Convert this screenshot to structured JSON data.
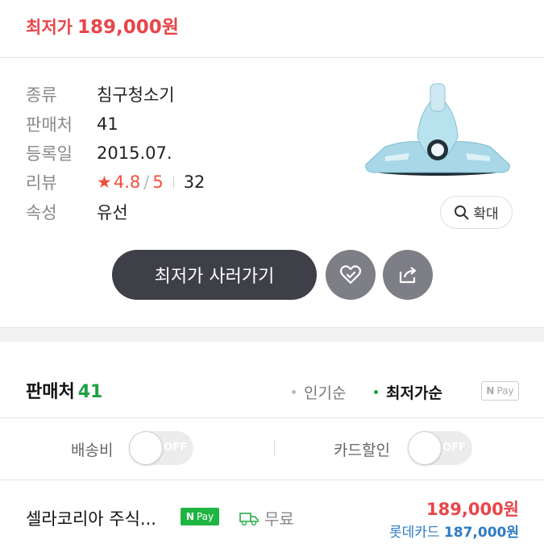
{
  "top": {
    "price_label": "최저가",
    "price": "189,000원"
  },
  "specs": [
    {
      "key": "종류",
      "value": "침구청소기"
    },
    {
      "key": "판매처",
      "value": "41"
    },
    {
      "key": "등록일",
      "value": "2015.07."
    },
    {
      "key": "리뷰",
      "rating": "4.8",
      "rating_max": "5",
      "count": "32"
    },
    {
      "key": "속성",
      "value": "유선"
    }
  ],
  "zoom_label": "확대",
  "buy_label": "최저가 사러가기",
  "sellers": {
    "title": "판매처",
    "count": "41",
    "sort_popular": "인기순",
    "sort_lowest": "최저가순",
    "npay_n": "N",
    "npay_label": "Pay"
  },
  "filters": {
    "shipping_label": "배송비",
    "card_label": "카드할인",
    "toggle_state": "OFF"
  },
  "rows": [
    {
      "name": "셀라코리아 주식...",
      "npay_n": "N",
      "npay_label": "Pay",
      "shipping": "무료",
      "price": "189,000원",
      "card_name": "롯데카드",
      "card_price": "187,000원"
    }
  ],
  "colors": {
    "accent": "#e8464a",
    "green": "#1fa045",
    "card_blue": "#2e7bc4",
    "button_dark": "#3e3f47"
  }
}
